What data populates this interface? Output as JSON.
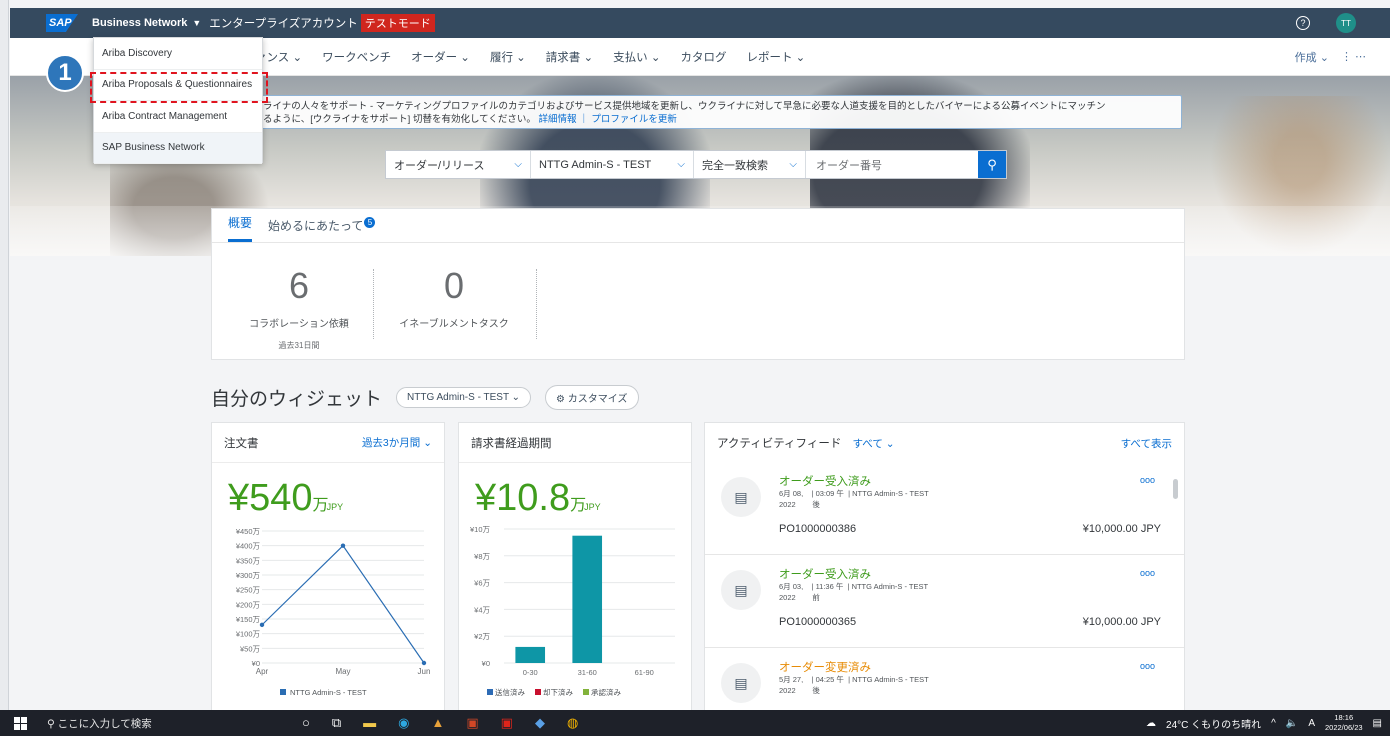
{
  "topbar": {
    "brand": "Business Network",
    "account": "エンタープライズアカウント",
    "test_mode": "テストモード",
    "help": "?",
    "avatar": "TT",
    "logo": "SAP"
  },
  "nav": {
    "items": [
      "ァンス ⌄",
      "ワークベンチ",
      "オーダー ⌄",
      "履行 ⌄",
      "請求書 ⌄",
      "支払い ⌄",
      "カタログ",
      "レポート ⌄"
    ],
    "create": "作成 ⌄",
    "more": "⋮  ⋯"
  },
  "dropdown": {
    "items": [
      "Ariba Discovery",
      "Ariba Proposals & Questionnaires",
      "Ariba Contract Management",
      "SAP Business Network"
    ]
  },
  "step_badge": "1",
  "banner": {
    "line1": "ライナの人々をサポート - マーケティングプロファイルのカテゴリおよびサービス提供地域を更新し、ウクライナに対して早急に必要な人道支援を目的としたバイヤーによる公募イベントにマッチン",
    "line2": "るように、[ウクライナをサポート] 切替を有効化してください。",
    "link1": "詳細情報",
    "sep": "｜",
    "link2": "プロファイルを更新"
  },
  "search": {
    "type": "オーダー/リリース",
    "customer": "NTTG Admin-S - TEST",
    "match": "完全一致検索",
    "placeholder": "オーダー番号"
  },
  "overview": {
    "tab1": "概要",
    "tab2": "始めるにあたって",
    "tab2_badge": "5",
    "m1_num": "6",
    "m1_label": "コラボレーション依頼",
    "m1_sub": "過去31日間",
    "m2_num": "0",
    "m2_label": "イネーブルメントタスク"
  },
  "widgets": {
    "title": "自分のウィジェット",
    "customer_pill": "NTTG Admin-S - TEST ⌄",
    "customize": "⚙ カスタマイズ"
  },
  "orders_card": {
    "title": "注文書",
    "period": "過去3か月間 ⌄",
    "amount": "¥540",
    "unit": "万",
    "currency": "JPY"
  },
  "invoice_card": {
    "title": "請求書経過期間",
    "amount": "¥10.8",
    "unit": "万",
    "currency": "JPY"
  },
  "feed_card": {
    "title": "アクティビティフィード",
    "filter": "すべて ⌄",
    "show_all": "すべて表示",
    "items": [
      {
        "title": "オーダー受入済み",
        "date": "6月 08,",
        "year": "2022",
        "time": "| 03:09 午",
        "ampm": "後",
        "customer": "| NTTG Admin-S - TEST",
        "po": "PO1000000386",
        "amount": "¥10,000.00 JPY",
        "color": "#3f9c1d"
      },
      {
        "title": "オーダー受入済み",
        "date": "6月 03,",
        "year": "2022",
        "time": "| 11:36 午",
        "ampm": "前",
        "customer": "| NTTG Admin-S - TEST",
        "po": "PO1000000365",
        "amount": "¥10,000.00 JPY",
        "color": "#3f9c1d"
      },
      {
        "title": "オーダー変更済み",
        "date": "5月 27,",
        "year": "2022",
        "time": "| 04:25 午",
        "ampm": "後",
        "customer": "| NTTG Admin-S - TEST",
        "po": "",
        "amount": "",
        "color": "#e78c07"
      }
    ]
  },
  "chart_data": [
    {
      "type": "line",
      "title": "",
      "categories": [
        "Apr",
        "May",
        "Jun"
      ],
      "series": [
        {
          "name": "NTTG Admin-S - TEST",
          "values": [
            130,
            400,
            0
          ]
        }
      ],
      "ylim": [
        0,
        450
      ],
      "yticks": [
        "¥0",
        "¥50万",
        "¥100万",
        "¥150万",
        "¥200万",
        "¥250万",
        "¥300万",
        "¥350万",
        "¥400万",
        "¥450万"
      ],
      "color": "#2a6db3"
    },
    {
      "type": "bar",
      "title": "",
      "categories": [
        "0-30",
        "31-60",
        "61-90"
      ],
      "values": [
        1.2,
        9.5,
        0
      ],
      "ylim": [
        0,
        10
      ],
      "yticks": [
        "¥0",
        "¥2万",
        "¥4万",
        "¥6万",
        "¥8万",
        "¥10万"
      ],
      "legend": [
        {
          "label": "送信済み",
          "color": "#2d6bb5"
        },
        {
          "label": "却下済み",
          "color": "#c8102e"
        },
        {
          "label": "承認済み",
          "color": "#82b33b"
        }
      ],
      "color": "#0e96a6"
    }
  ],
  "taskbar": {
    "search": "ここに入力して検索",
    "weather": "24°C くもりのち晴れ",
    "time": "18:16",
    "date": "2022/06/23",
    "ime": "A"
  }
}
